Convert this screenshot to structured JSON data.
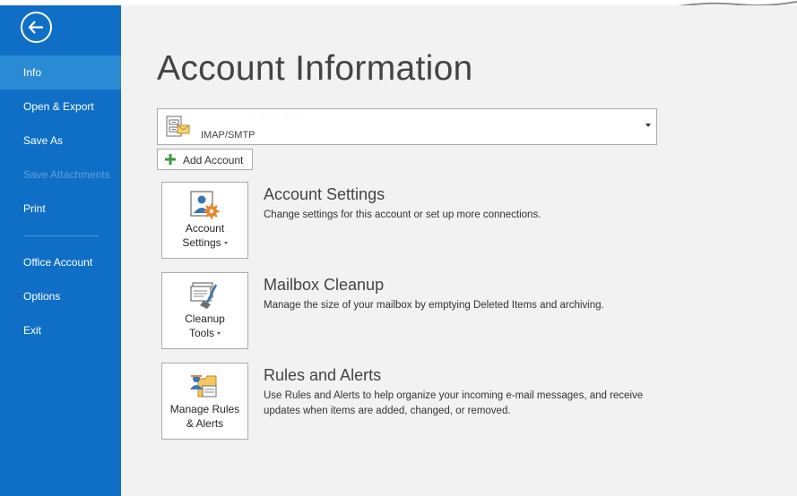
{
  "sidebar": {
    "back_label": "Back",
    "items": [
      {
        "label": "Info"
      },
      {
        "label": "Open & Export"
      },
      {
        "label": "Save As"
      },
      {
        "label": "Save Attachments"
      },
      {
        "label": "Print"
      },
      {
        "label": "Office Account"
      },
      {
        "label": "Options"
      },
      {
        "label": "Exit"
      }
    ],
    "active_item": "Info",
    "disabled_item": "Save Attachments"
  },
  "main": {
    "title": "Account Information",
    "account_selector": {
      "account_name": "· · · · · · ·",
      "account_type": "IMAP/SMTP"
    },
    "add_account_label": "Add Account",
    "sections": [
      {
        "tile_line1": "Account",
        "tile_line2": "Settings",
        "title": "Account Settings",
        "description": "Change settings for this account or set up more connections."
      },
      {
        "tile_line1": "Cleanup",
        "tile_line2": "Tools",
        "title": "Mailbox Cleanup",
        "description": "Manage the size of your mailbox by emptying Deleted Items and archiving."
      },
      {
        "tile_line1": "Manage Rules",
        "tile_line2": "& Alerts",
        "title": "Rules and Alerts",
        "description": "Use Rules and Alerts to help organize your incoming e-mail messages, and receive updates when items are added, changed, or removed."
      }
    ]
  },
  "colors": {
    "sidebar_bg": "#0f6fc6",
    "sidebar_active": "#2a8ad4",
    "main_bg": "#f2f2f2",
    "add_icon_green": "#3c9a3c"
  },
  "icons": [
    "back-arrow-icon",
    "account-icon",
    "plus-icon",
    "account-settings-icon",
    "cleanup-tools-icon",
    "rules-alerts-icon"
  ]
}
